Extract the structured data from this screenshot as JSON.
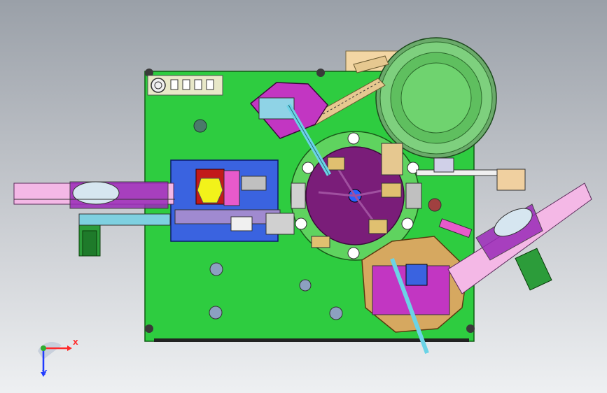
{
  "view": {
    "axes": {
      "x_label": "X",
      "y_label": "Y"
    }
  },
  "colors": {
    "background_top": "#9aa0a8",
    "background_bottom": "#eef0f2",
    "base_plate": "#2ecc40",
    "bowl": "#6fd36f",
    "turntable": "#7a1d79",
    "turntable_ring": "#5fd35f",
    "blue_station": "#3a63e0",
    "yellow_part": "#f2f21a",
    "magenta_parts": "#c236c2",
    "cyan_rails": "#6bd3e6",
    "pink_belts": "#f4b8e6",
    "tan_panel": "#f3d6a4",
    "green_motors": "#2c9c3a",
    "axis_x": "#ff2a2a",
    "axis_y": "#1f3bff",
    "axis_z": "#2fae2f"
  },
  "icons": [
    "coordinate-triad-icon"
  ]
}
